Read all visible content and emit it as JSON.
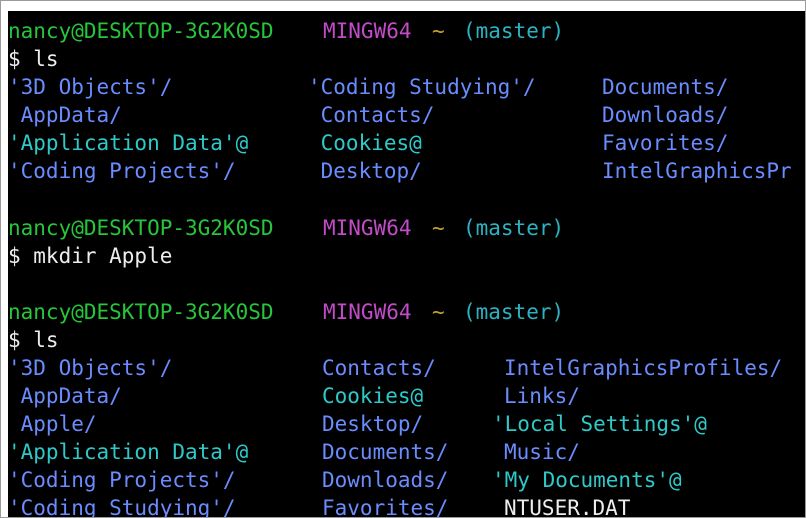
{
  "colors": {
    "background": "#000000",
    "user_host": "#27c63a",
    "system": "#c24bc8",
    "path": "#c3a12e",
    "branch": "#2bb3c2",
    "directory": "#6a8cff",
    "symlink": "#2ec9c9",
    "text": "#ededed"
  },
  "prompt": {
    "user_host": "nancy@DESKTOP-3G2K0SD",
    "system": "MINGW64",
    "path": "~",
    "branch": "(master)"
  },
  "commands": {
    "ls_1": "$ ls",
    "mkdir": "$ mkdir Apple",
    "ls_2": "$ ls"
  },
  "listing_1": {
    "col1": [
      "'3D Objects'/",
      " AppData/",
      "'Application Data'@",
      "'Coding Projects'/"
    ],
    "col2": [
      "'Coding Studying'/",
      " Contacts/",
      " Cookies@",
      " Desktop/"
    ],
    "col3": [
      "Documents/",
      "Downloads/",
      "Favorites/",
      "IntelGraphicsPr"
    ]
  },
  "listing_2": {
    "col1": [
      "'3D Objects'/",
      " AppData/",
      " Apple/",
      "'Application Data'@",
      "'Coding Projects'/",
      "'Coding Studying'/"
    ],
    "col2": [
      "Contacts/",
      "Cookies@",
      "Desktop/",
      "Documents/",
      "Downloads/",
      "Favorites/"
    ],
    "col3": [
      "IntelGraphicsProfiles/",
      "Links/",
      "'Local Settings'@",
      "Music/",
      "'My Documents'@",
      "NTUSER.DAT"
    ]
  }
}
